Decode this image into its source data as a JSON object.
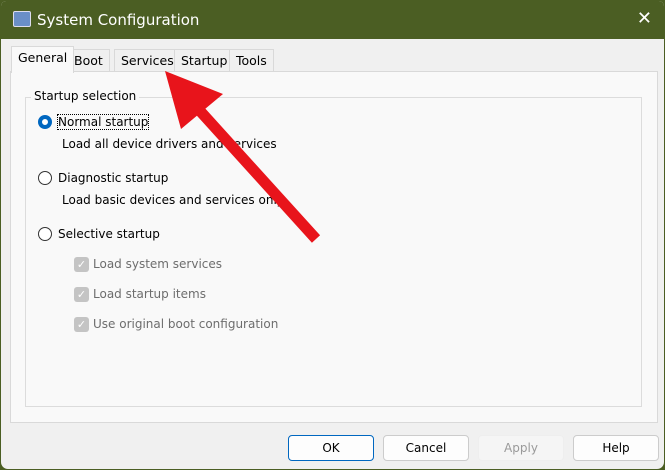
{
  "window": {
    "title": "System Configuration"
  },
  "tabs": [
    "General",
    "Boot",
    "Services",
    "Startup",
    "Tools"
  ],
  "group": {
    "label": "Startup selection"
  },
  "options": [
    {
      "label": "Normal startup",
      "desc": "Load all device drivers and services",
      "selected": true
    },
    {
      "label": "Diagnostic startup",
      "desc": "Load basic devices and services only",
      "selected": false
    },
    {
      "label": "Selective startup",
      "selected": false
    }
  ],
  "checks": [
    {
      "label": "Load system services",
      "checked": true
    },
    {
      "label": "Load startup items",
      "checked": true
    },
    {
      "label": "Use original boot configuration",
      "checked": true
    }
  ],
  "buttons": {
    "ok": "OK",
    "cancel": "Cancel",
    "apply": "Apply",
    "help": "Help"
  },
  "annotation": {
    "arrow_color": "#e8141b"
  }
}
